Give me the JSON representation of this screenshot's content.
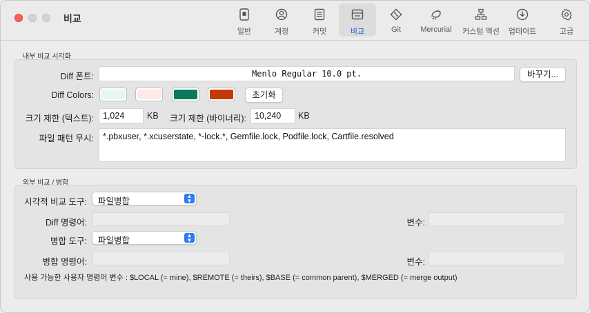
{
  "window": {
    "title": "비교"
  },
  "toolbar": {
    "tabs": [
      {
        "label": "일반",
        "icon": "general-icon"
      },
      {
        "label": "계정",
        "icon": "account-icon"
      },
      {
        "label": "커밋",
        "icon": "commit-icon"
      },
      {
        "label": "비교",
        "icon": "diff-icon",
        "active": true
      },
      {
        "label": "Git",
        "icon": "git-icon"
      },
      {
        "label": "Mercurial",
        "icon": "mercurial-icon"
      },
      {
        "label": "커스텀 액션",
        "icon": "custom-actions-icon"
      },
      {
        "label": "업데이트",
        "icon": "update-icon"
      },
      {
        "label": "고급",
        "icon": "gear-icon"
      }
    ]
  },
  "internal": {
    "section_title": "내부 비교 시각화",
    "font_label": "Diff 폰트:",
    "font_value": "Menlo Regular 10.0 pt.",
    "change_button": "바꾸기...",
    "colors_label": "Diff Colors:",
    "colors": [
      "#e6f8ee",
      "#fbeae6",
      "#0b7a5a",
      "#c43a06"
    ],
    "reset_button": "초기화",
    "size_text_label": "크기 제한 (텍스트):",
    "size_text_value": "1,024",
    "size_text_unit": "KB",
    "size_binary_label": "크기 제한 (바이너리):",
    "size_binary_value": "10,240",
    "size_binary_unit": "KB",
    "ignore_label": "파일 패턴 무시:",
    "ignore_value": "*.pbxuser, *.xcuserstate, *-lock.*, Gemfile.lock, Podfile.lock, Cartfile.resolved"
  },
  "external": {
    "section_title": "외부 비교 / 병합",
    "visual_diff_label": "시각적 비교 도구:",
    "visual_diff_value": "파일병합",
    "diff_command_label": "Diff 명령어:",
    "diff_command_value": "",
    "diff_args_label": "변수:",
    "diff_args_value": "",
    "merge_tool_label": "병합 도구:",
    "merge_tool_value": "파일병합",
    "merge_command_label": "병합 명령어:",
    "merge_command_value": "",
    "merge_args_label": "변수:",
    "merge_args_value": "",
    "note": "사용 가능한 사용자 명령어 변수 : $LOCAL (= mine), $REMOTE (= theirs), $BASE (= common parent), $MERGED (= merge output)"
  }
}
